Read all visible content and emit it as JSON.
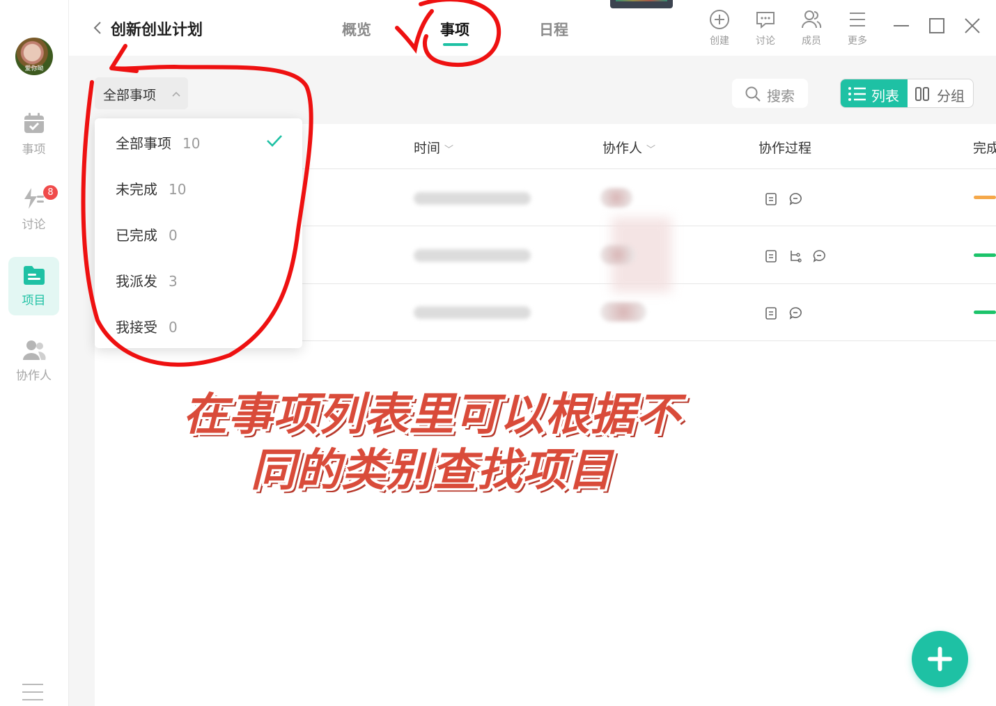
{
  "nav": {
    "avatar_caption": "爱你呦",
    "items": [
      {
        "label": "事项"
      },
      {
        "label": "讨论",
        "badge": "8"
      },
      {
        "label": "项目"
      },
      {
        "label": "协作人"
      }
    ]
  },
  "header": {
    "project_title": "创新创业计划",
    "tabs": [
      {
        "label": "概览"
      },
      {
        "label": "事项"
      },
      {
        "label": "日程"
      }
    ],
    "tools": [
      {
        "label": "创建",
        "icon": "plus-circle-icon"
      },
      {
        "label": "讨论",
        "icon": "chat-icon"
      },
      {
        "label": "成员",
        "icon": "members-icon"
      },
      {
        "label": "更多",
        "icon": "menu-icon"
      }
    ]
  },
  "toolbar": {
    "filter_label": "全部事项",
    "search_label": "搜索",
    "view_list_label": "列表",
    "view_group_label": "分组"
  },
  "table": {
    "columns": [
      "时间",
      "协作人",
      "协作过程",
      "完成"
    ],
    "row_count": 3,
    "progress_colors": [
      "#f5a84a",
      "#1cc36a",
      "#1cc36a"
    ]
  },
  "dropdown": {
    "items": [
      {
        "label": "全部事项",
        "count": "10",
        "selected": true
      },
      {
        "label": "未完成",
        "count": "10"
      },
      {
        "label": "已完成",
        "count": "0"
      },
      {
        "label": "我派发",
        "count": "3"
      },
      {
        "label": "我接受",
        "count": "0"
      }
    ]
  },
  "annotation": {
    "line1": "在事项列表里可以根据不",
    "line2": "同的类别查找项目",
    "color": "#d94b3a"
  },
  "colors": {
    "accent": "#1ec1a4",
    "badge": "#f04b4b",
    "annotation_stroke": "#ee1111"
  }
}
